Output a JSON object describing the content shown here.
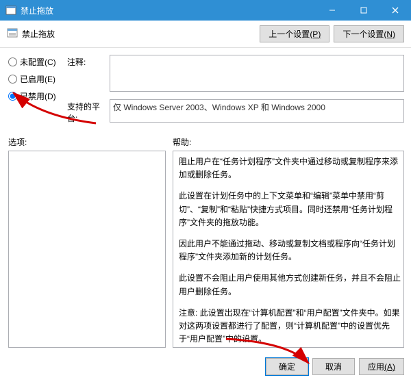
{
  "window": {
    "title": "禁止拖放",
    "subtitle": "禁止拖放"
  },
  "nav": {
    "prev": "上一个设置",
    "prev_accel": "(P)",
    "next": "下一个设置",
    "next_accel": "(N)"
  },
  "radios": {
    "notconf": "未配置",
    "notconf_accel": "(C)",
    "enabled": "已启用",
    "enabled_accel": "(E)",
    "disabled": "已禁用",
    "disabled_accel": "(D)"
  },
  "labels": {
    "comment": "注释:",
    "platform": "支持的平台:",
    "options": "选项:",
    "help": "帮助:"
  },
  "values": {
    "comment": "",
    "platform": "仅 Windows Server 2003、Windows XP 和 Windows 2000"
  },
  "help": {
    "p1": "阻止用户在“任务计划程序”文件夹中通过移动或复制程序来添加或删除任务。",
    "p2": "此设置在计划任务中的上下文菜单和“编辑”菜单中禁用“剪切”、“复制”和“粘贴”快捷方式项目。同时还禁用“任务计划程序”文件夹的拖放功能。",
    "p3": "因此用户不能通过拖动、移动或复制文档或程序向“任务计划程序”文件夹添加新的计划任务。",
    "p4": "此设置不会阻止用户使用其他方式创建新任务，并且不会阻止用户删除任务。",
    "p5": "注意: 此设置出现在“计算机配置”和“用户配置”文件夹中。如果对这两项设置都进行了配置，则“计算机配置”中的设置优先于“用户配置”中的设置。"
  },
  "footer": {
    "ok": "确定",
    "cancel": "取消",
    "apply": "应用",
    "apply_accel": "(A)"
  }
}
